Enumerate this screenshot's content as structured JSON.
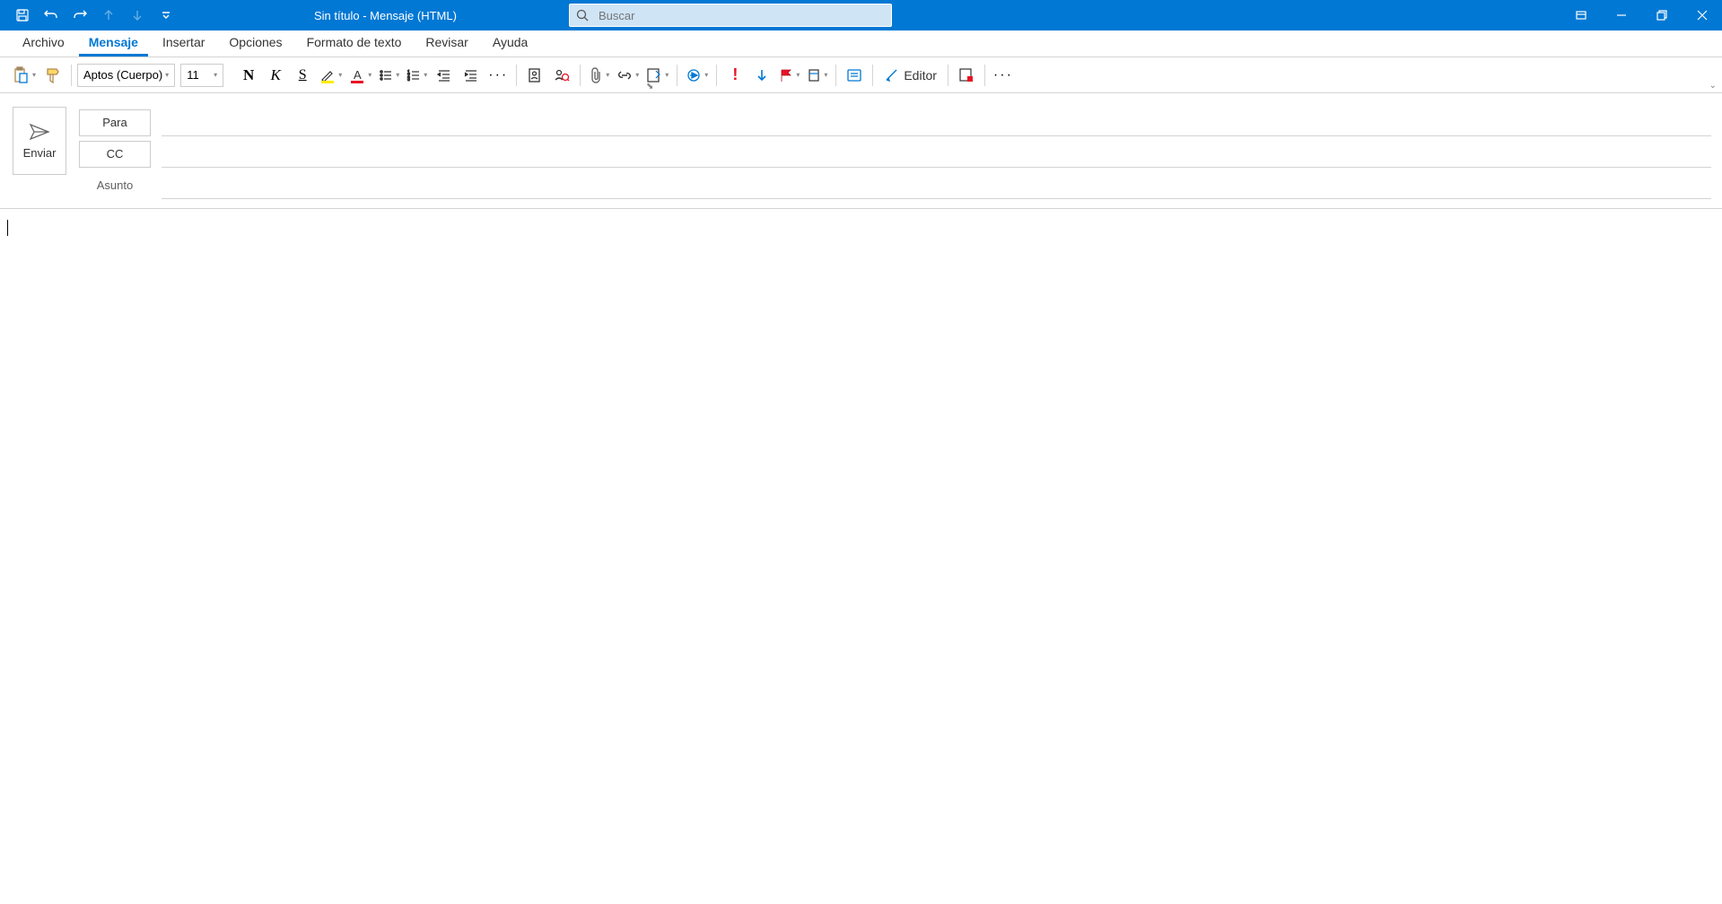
{
  "title": "Sin título  -  Mensaje (HTML)",
  "search": {
    "placeholder": "Buscar"
  },
  "tabs": {
    "archivo": "Archivo",
    "mensaje": "Mensaje",
    "insertar": "Insertar",
    "opciones": "Opciones",
    "formato": "Formato de texto",
    "revisar": "Revisar",
    "ayuda": "Ayuda"
  },
  "ribbon": {
    "font_name": "Aptos (Cuerpo)",
    "font_size": "11",
    "editor": "Editor"
  },
  "compose": {
    "send": "Enviar",
    "to": "Para",
    "cc": "CC",
    "subject": "Asunto"
  }
}
